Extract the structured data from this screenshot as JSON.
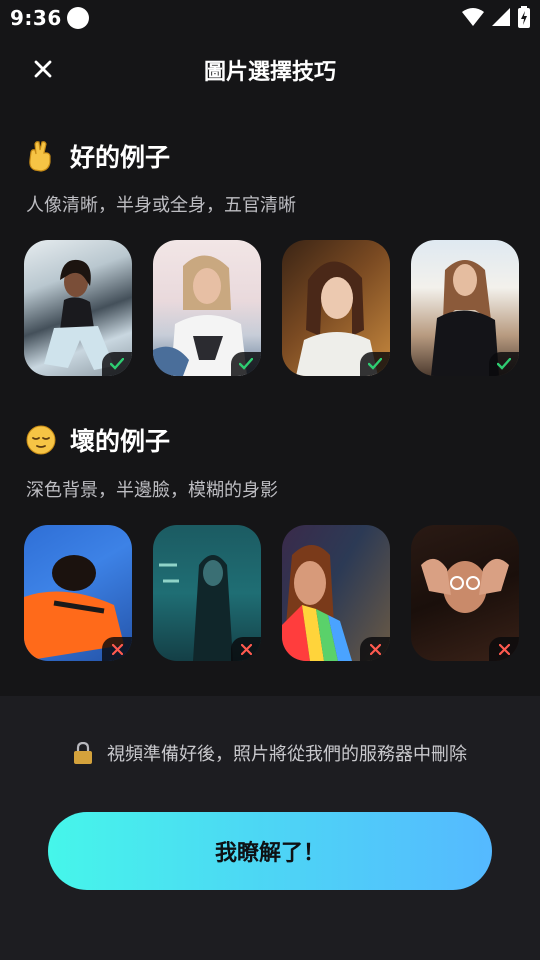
{
  "status": {
    "time": "9:36"
  },
  "header": {
    "title": "圖片選擇技巧"
  },
  "good": {
    "emoji": "crossed-fingers",
    "title": "好的例子",
    "desc": "人像清晰，半身或全身，五官清晰",
    "photos": [
      "woman on bleachers",
      "woman in white top",
      "woman with braids",
      "woman in black dress"
    ]
  },
  "bad": {
    "emoji": "relieved-face",
    "title": "壞的例子",
    "desc": "深色背景，半邊臉，模糊的身影",
    "photos": [
      "person in orange shirt lying down",
      "silhouette against teal door",
      "blurry face with rainbow light",
      "woman with hands framing face"
    ]
  },
  "footer": {
    "privacy_text": "視頻準備好後，照片將從我們的服務器中刪除",
    "cta_label": "我瞭解了！"
  },
  "colors": {
    "background": "#151517",
    "panel": "#1d1d21",
    "check": "#2ecc71",
    "cross": "#ff5a4f",
    "cta_start": "#46f6ea",
    "cta_end": "#55b9ff"
  }
}
